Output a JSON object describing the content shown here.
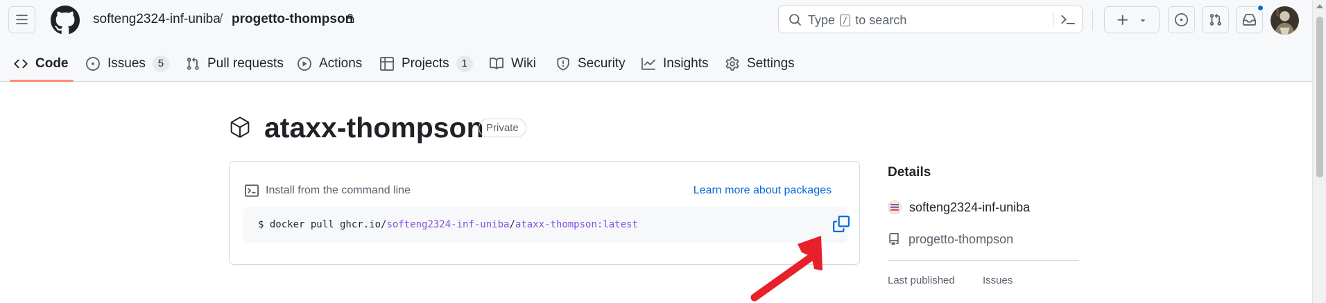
{
  "header": {
    "owner": "softeng2324-inf-uniba",
    "separator": "/",
    "repo": "progetto-thompson",
    "search": {
      "prefix": "Type",
      "shortcut": "/",
      "suffix": "to search"
    }
  },
  "repo_nav": {
    "items": [
      {
        "label": "Code",
        "icon": "code-icon",
        "selected": true
      },
      {
        "label": "Issues",
        "icon": "issue-opened-icon",
        "count": "5"
      },
      {
        "label": "Pull requests",
        "icon": "git-pull-request-icon"
      },
      {
        "label": "Actions",
        "icon": "play-icon"
      },
      {
        "label": "Projects",
        "icon": "table-icon",
        "count": "1"
      },
      {
        "label": "Wiki",
        "icon": "book-icon"
      },
      {
        "label": "Security",
        "icon": "shield-icon"
      },
      {
        "label": "Insights",
        "icon": "graph-icon"
      },
      {
        "label": "Settings",
        "icon": "gear-icon"
      }
    ]
  },
  "package": {
    "name": "ataxx-thompson",
    "visibility": "Private"
  },
  "install": {
    "heading": "Install from the command line",
    "learn_more": "Learn more about packages",
    "command_prefix": "$ docker pull ghcr.io/",
    "command_owner": "softeng2324-inf-uniba",
    "command_sep": "/",
    "command_image": "ataxx-thompson:latest"
  },
  "sidebar": {
    "title": "Details",
    "owner": "softeng2324-inf-uniba",
    "repository": "progetto-thompson",
    "last_published_label": "Last published",
    "issues_label": "Issues"
  },
  "colors": {
    "accent_blue": "#0969da",
    "nav_underline": "#fd8c73",
    "annotation_arrow": "#e8202a",
    "purple_code": "#8250df"
  }
}
